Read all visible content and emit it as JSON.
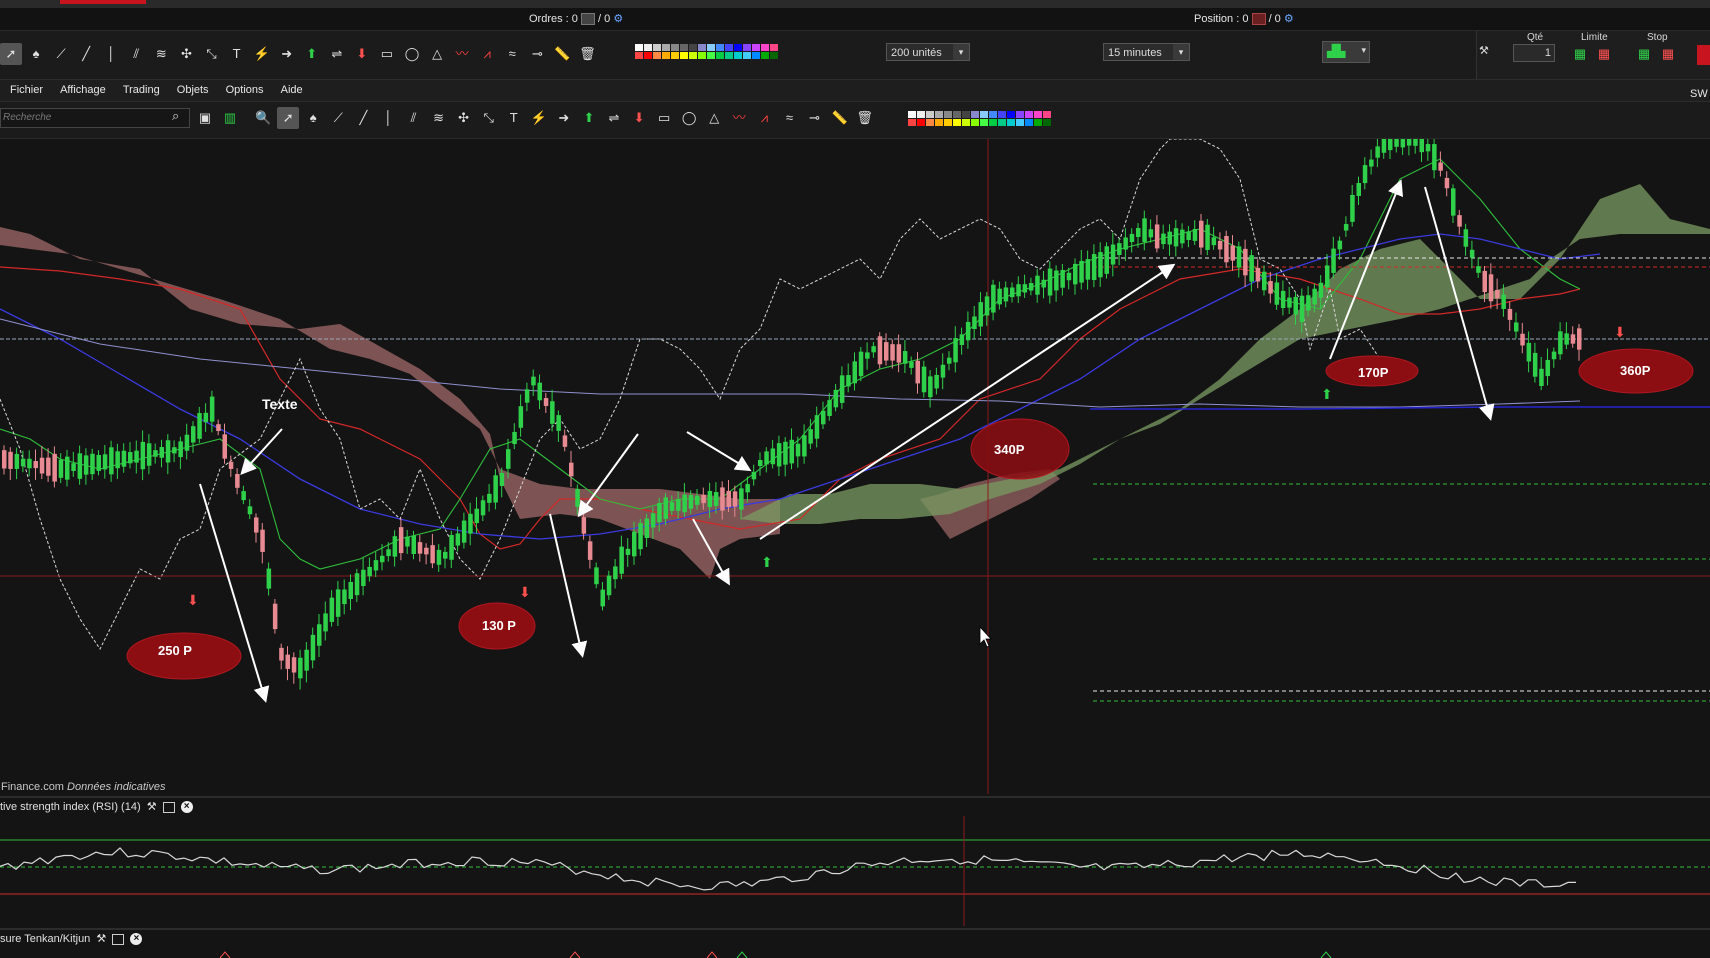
{
  "status": {
    "orders_label": "Ordres :",
    "orders_value": "0",
    "orders_sep": "/ 0",
    "position_label": "Position :",
    "position_value": "0",
    "position_sep": "/ 0"
  },
  "toolbar": {
    "size_select": "200 unités",
    "timeframe_select": "15 minutes",
    "qty_label": "Qté",
    "qty_value": "1",
    "limit_label": "Limite",
    "stop_label": "Stop",
    "sw_label": "SW"
  },
  "menu": {
    "items": [
      "Fichier",
      "Affichage",
      "Trading",
      "Objets",
      "Options",
      "Aide"
    ]
  },
  "search": {
    "placeholder": "Recherche"
  },
  "chart": {
    "source_text": "Finance.com",
    "source_note": "Données indicatives",
    "annotations": {
      "texte": "Texte",
      "p250": "250 P",
      "p130": "130 P",
      "p340": "340P",
      "p170": "170P",
      "p360": "360P"
    }
  },
  "indicators": {
    "rsi_label": "tive strength index (RSI) (14)",
    "tenkan_label": "sure Tenkan/Kitjun"
  },
  "colors": {
    "background": "#141414",
    "candle_up": "#2fd14a",
    "candle_down": "#e88a92",
    "cloud_bear": "#a06868",
    "cloud_bull": "#7a9b62",
    "annotation": "#8c0d12"
  }
}
